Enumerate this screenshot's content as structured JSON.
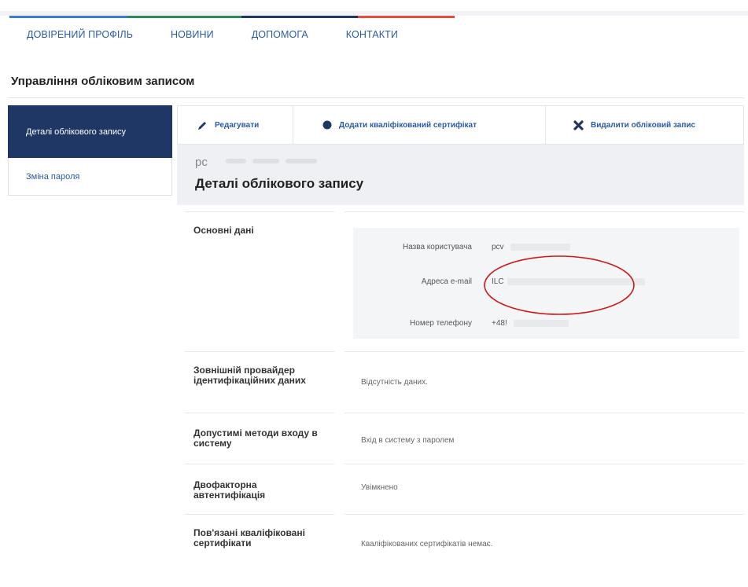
{
  "nav": {
    "items": [
      "ДОВІРЕНИЙ ПРОФІЛЬ",
      "НОВИНИ",
      "ДОПОМОГА",
      "КОНТАКТИ"
    ],
    "stripe_colors": [
      "#3a7bd5",
      "#2e8b57",
      "#1e3764",
      "#e74c3c"
    ]
  },
  "page_title": "Управління обліковим записом",
  "sidebar": {
    "active": "Деталі облікового запису",
    "password": "Зміна пароля"
  },
  "actions": {
    "edit": "Редагувати",
    "add_cert": "Додати кваліфікований сертифікат",
    "delete": "Видалити обліковий запис"
  },
  "header": {
    "user_short": "pc",
    "title": "Деталі облікового запису"
  },
  "basic": {
    "label": "Основні дані",
    "username_label": "Назва користувача",
    "username_value": "pcv",
    "email_label": "Адреса e-mail",
    "email_value": "ILC",
    "phone_label": "Номер телефону",
    "phone_value": "+48!"
  },
  "rows": {
    "provider_label": "Зовнішній провайдер ідентифікаційних даних",
    "provider_value": "Відсутність даних.",
    "login_label": "Допустимі методи входу в систему",
    "login_value": "Вхід в систему з паролем",
    "twofa_label": "Двофакторна автентифікація",
    "twofa_value": "Увімкнено",
    "certs_label": "Пов'язані кваліфіковані сертифікати",
    "certs_value": "Кваліфікованих сертифікатів немає."
  },
  "colors": {
    "link": "#2a5aa8",
    "sidebar_active": "#1e3764",
    "annotation": "#cc1a1a"
  },
  "icons": {
    "edit": "pencil-icon",
    "add_cert": "circle-icon",
    "delete": "x-icon"
  }
}
